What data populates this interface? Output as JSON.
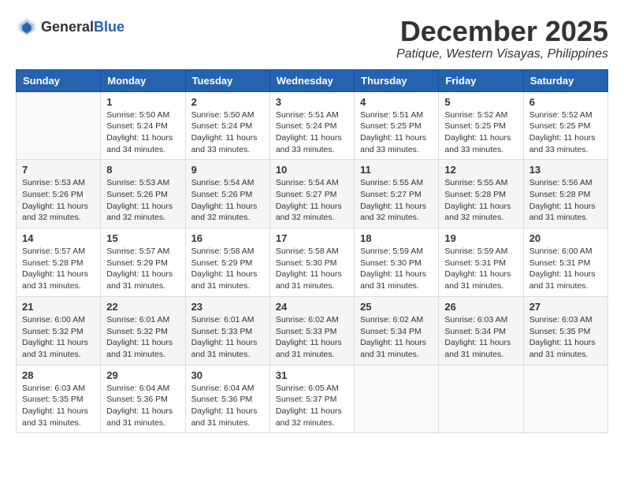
{
  "header": {
    "logo_general": "General",
    "logo_blue": "Blue",
    "month_title": "December 2025",
    "location": "Patique, Western Visayas, Philippines"
  },
  "days_of_week": [
    "Sunday",
    "Monday",
    "Tuesday",
    "Wednesday",
    "Thursday",
    "Friday",
    "Saturday"
  ],
  "weeks": [
    [
      {
        "day": "",
        "info": ""
      },
      {
        "day": "1",
        "info": "Sunrise: 5:50 AM\nSunset: 5:24 PM\nDaylight: 11 hours\nand 34 minutes."
      },
      {
        "day": "2",
        "info": "Sunrise: 5:50 AM\nSunset: 5:24 PM\nDaylight: 11 hours\nand 33 minutes."
      },
      {
        "day": "3",
        "info": "Sunrise: 5:51 AM\nSunset: 5:24 PM\nDaylight: 11 hours\nand 33 minutes."
      },
      {
        "day": "4",
        "info": "Sunrise: 5:51 AM\nSunset: 5:25 PM\nDaylight: 11 hours\nand 33 minutes."
      },
      {
        "day": "5",
        "info": "Sunrise: 5:52 AM\nSunset: 5:25 PM\nDaylight: 11 hours\nand 33 minutes."
      },
      {
        "day": "6",
        "info": "Sunrise: 5:52 AM\nSunset: 5:25 PM\nDaylight: 11 hours\nand 33 minutes."
      }
    ],
    [
      {
        "day": "7",
        "info": "Sunrise: 5:53 AM\nSunset: 5:26 PM\nDaylight: 11 hours\nand 32 minutes."
      },
      {
        "day": "8",
        "info": "Sunrise: 5:53 AM\nSunset: 5:26 PM\nDaylight: 11 hours\nand 32 minutes."
      },
      {
        "day": "9",
        "info": "Sunrise: 5:54 AM\nSunset: 5:26 PM\nDaylight: 11 hours\nand 32 minutes."
      },
      {
        "day": "10",
        "info": "Sunrise: 5:54 AM\nSunset: 5:27 PM\nDaylight: 11 hours\nand 32 minutes."
      },
      {
        "day": "11",
        "info": "Sunrise: 5:55 AM\nSunset: 5:27 PM\nDaylight: 11 hours\nand 32 minutes."
      },
      {
        "day": "12",
        "info": "Sunrise: 5:55 AM\nSunset: 5:28 PM\nDaylight: 11 hours\nand 32 minutes."
      },
      {
        "day": "13",
        "info": "Sunrise: 5:56 AM\nSunset: 5:28 PM\nDaylight: 11 hours\nand 31 minutes."
      }
    ],
    [
      {
        "day": "14",
        "info": "Sunrise: 5:57 AM\nSunset: 5:28 PM\nDaylight: 11 hours\nand 31 minutes."
      },
      {
        "day": "15",
        "info": "Sunrise: 5:57 AM\nSunset: 5:29 PM\nDaylight: 11 hours\nand 31 minutes."
      },
      {
        "day": "16",
        "info": "Sunrise: 5:58 AM\nSunset: 5:29 PM\nDaylight: 11 hours\nand 31 minutes."
      },
      {
        "day": "17",
        "info": "Sunrise: 5:58 AM\nSunset: 5:30 PM\nDaylight: 11 hours\nand 31 minutes."
      },
      {
        "day": "18",
        "info": "Sunrise: 5:59 AM\nSunset: 5:30 PM\nDaylight: 11 hours\nand 31 minutes."
      },
      {
        "day": "19",
        "info": "Sunrise: 5:59 AM\nSunset: 5:31 PM\nDaylight: 11 hours\nand 31 minutes."
      },
      {
        "day": "20",
        "info": "Sunrise: 6:00 AM\nSunset: 5:31 PM\nDaylight: 11 hours\nand 31 minutes."
      }
    ],
    [
      {
        "day": "21",
        "info": "Sunrise: 6:00 AM\nSunset: 5:32 PM\nDaylight: 11 hours\nand 31 minutes."
      },
      {
        "day": "22",
        "info": "Sunrise: 6:01 AM\nSunset: 5:32 PM\nDaylight: 11 hours\nand 31 minutes."
      },
      {
        "day": "23",
        "info": "Sunrise: 6:01 AM\nSunset: 5:33 PM\nDaylight: 11 hours\nand 31 minutes."
      },
      {
        "day": "24",
        "info": "Sunrise: 6:02 AM\nSunset: 5:33 PM\nDaylight: 11 hours\nand 31 minutes."
      },
      {
        "day": "25",
        "info": "Sunrise: 6:02 AM\nSunset: 5:34 PM\nDaylight: 11 hours\nand 31 minutes."
      },
      {
        "day": "26",
        "info": "Sunrise: 6:03 AM\nSunset: 5:34 PM\nDaylight: 11 hours\nand 31 minutes."
      },
      {
        "day": "27",
        "info": "Sunrise: 6:03 AM\nSunset: 5:35 PM\nDaylight: 11 hours\nand 31 minutes."
      }
    ],
    [
      {
        "day": "28",
        "info": "Sunrise: 6:03 AM\nSunset: 5:35 PM\nDaylight: 11 hours\nand 31 minutes."
      },
      {
        "day": "29",
        "info": "Sunrise: 6:04 AM\nSunset: 5:36 PM\nDaylight: 11 hours\nand 31 minutes."
      },
      {
        "day": "30",
        "info": "Sunrise: 6:04 AM\nSunset: 5:36 PM\nDaylight: 11 hours\nand 31 minutes."
      },
      {
        "day": "31",
        "info": "Sunrise: 6:05 AM\nSunset: 5:37 PM\nDaylight: 11 hours\nand 32 minutes."
      },
      {
        "day": "",
        "info": ""
      },
      {
        "day": "",
        "info": ""
      },
      {
        "day": "",
        "info": ""
      }
    ]
  ]
}
